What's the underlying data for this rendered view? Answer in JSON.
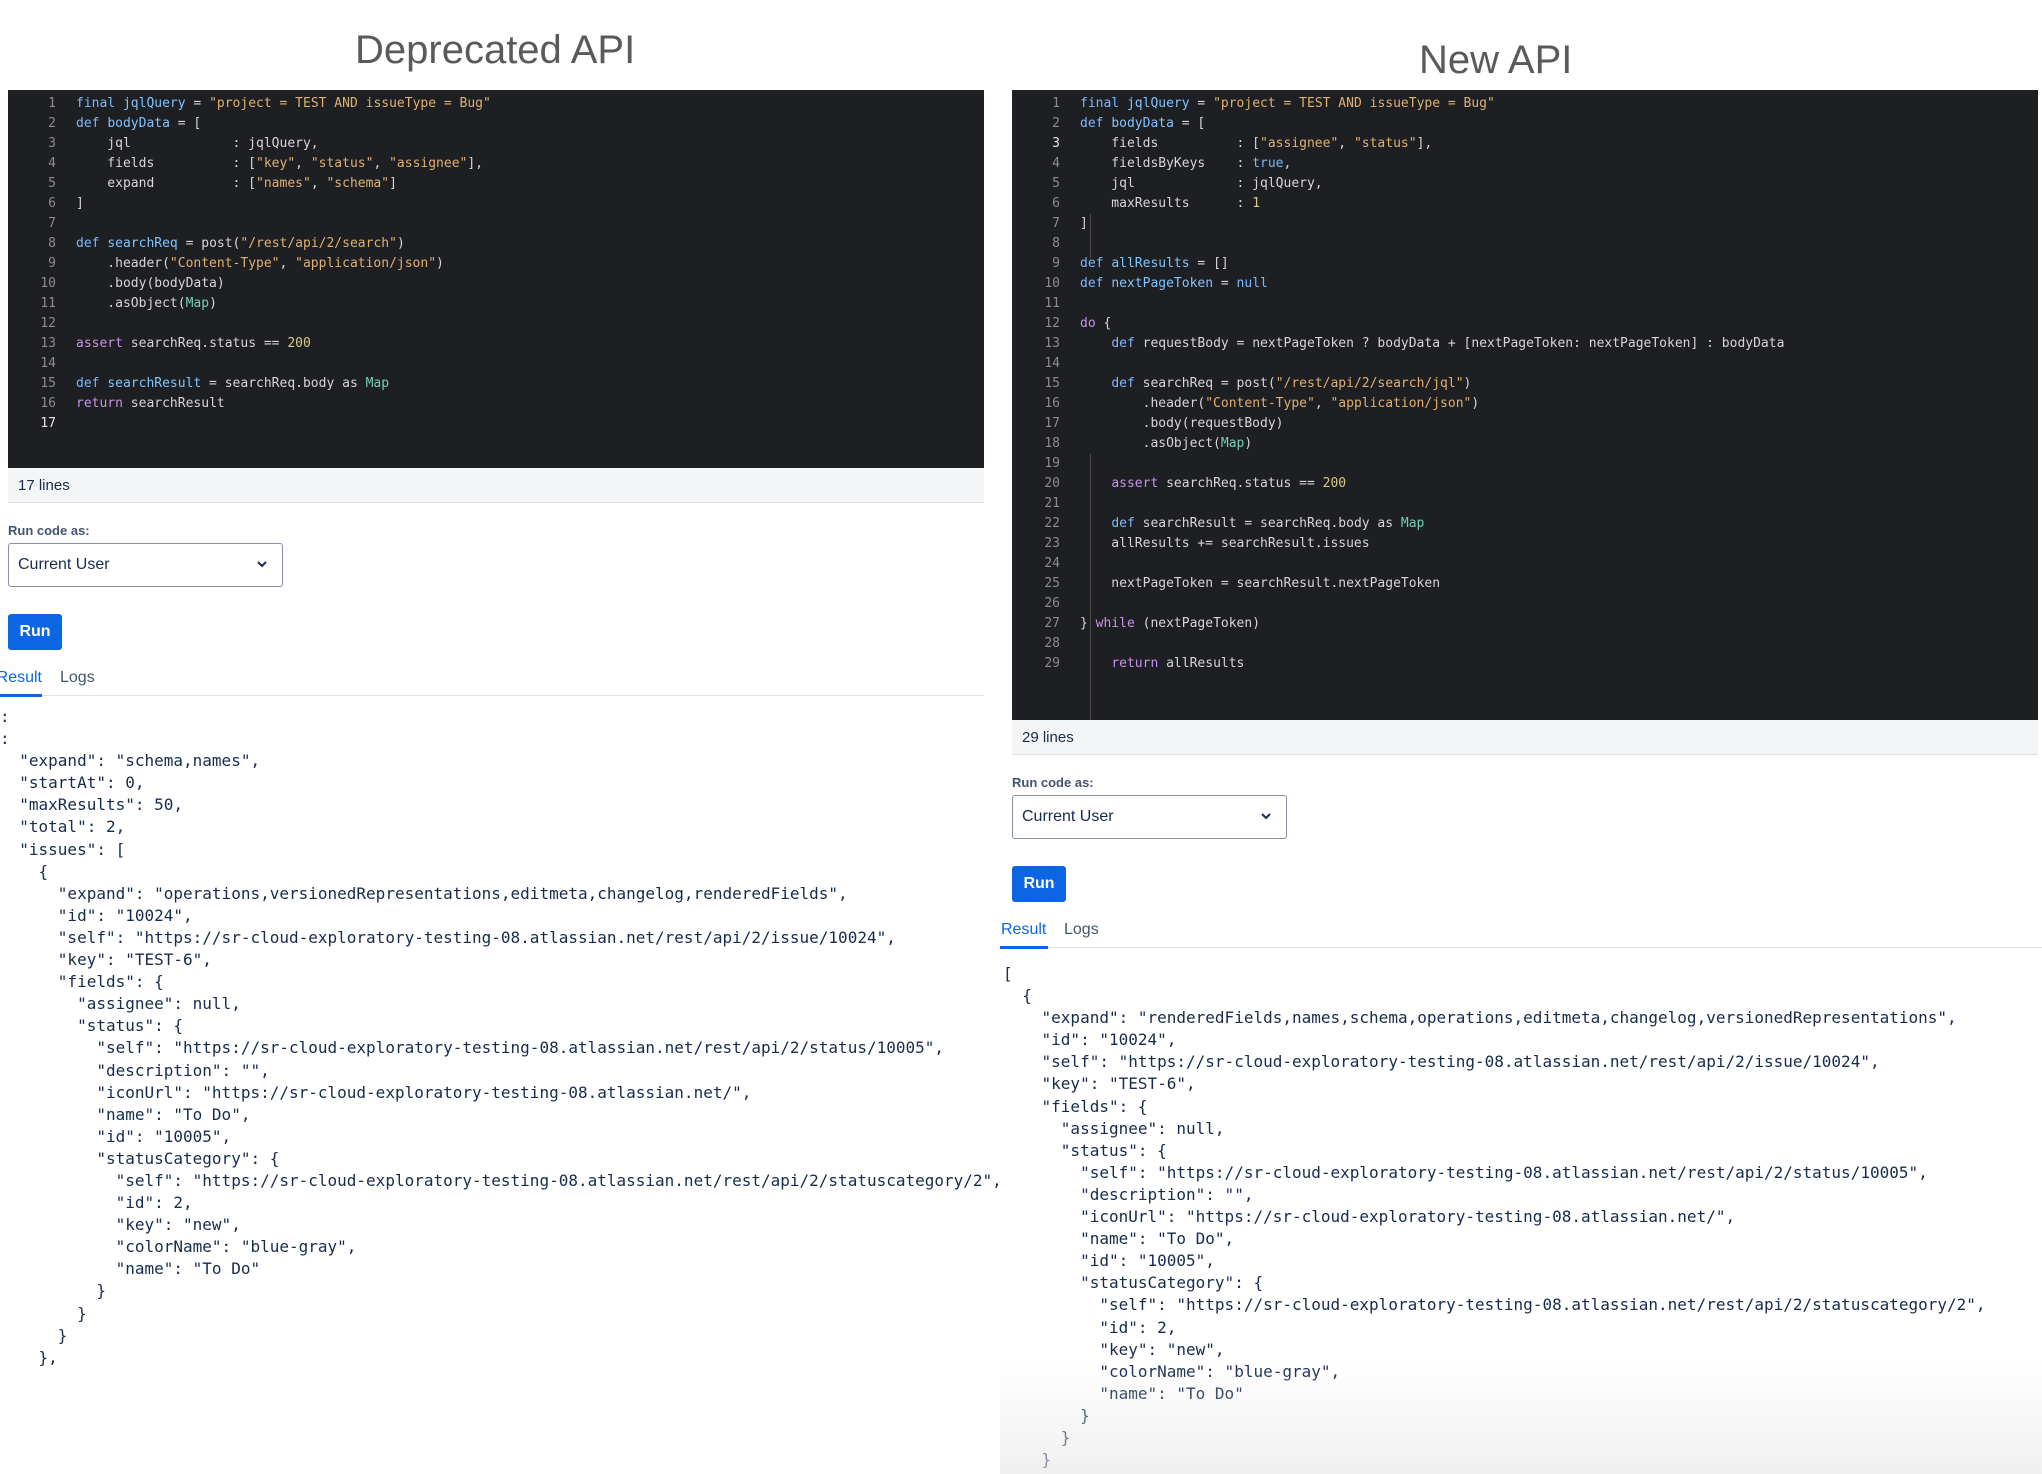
{
  "deprecated": {
    "title": "Deprecated API",
    "code_lines": [
      [
        [
          "kb",
          "final "
        ],
        [
          "fn",
          "jqlQuery"
        ],
        [
          "t",
          " = "
        ],
        [
          "str",
          "\"project = TEST AND issueType = Bug\""
        ]
      ],
      [
        [
          "kb",
          "def "
        ],
        [
          "fn",
          "bodyData"
        ],
        [
          "t",
          " = ["
        ]
      ],
      [
        [
          "t",
          "    jql             : jqlQuery,"
        ]
      ],
      [
        [
          "t",
          "    fields          : ["
        ],
        [
          "str",
          "\"key\""
        ],
        [
          "t",
          ", "
        ],
        [
          "str",
          "\"status\""
        ],
        [
          "t",
          ", "
        ],
        [
          "str",
          "\"assignee\""
        ],
        [
          "t",
          "],"
        ]
      ],
      [
        [
          "t",
          "    expand          : ["
        ],
        [
          "str",
          "\"names\""
        ],
        [
          "t",
          ", "
        ],
        [
          "str",
          "\"schema\""
        ],
        [
          "t",
          "]"
        ]
      ],
      [
        [
          "t",
          "]"
        ]
      ],
      [],
      [
        [
          "kb",
          "def "
        ],
        [
          "fn",
          "searchReq"
        ],
        [
          "t",
          " = post("
        ],
        [
          "str",
          "\"/rest/api/2/search\""
        ],
        [
          "t",
          ")"
        ]
      ],
      [
        [
          "t",
          "    .header("
        ],
        [
          "str",
          "\"Content-Type\""
        ],
        [
          "t",
          ", "
        ],
        [
          "str",
          "\"application/json\""
        ],
        [
          "t",
          ")"
        ]
      ],
      [
        [
          "t",
          "    .body(bodyData)"
        ]
      ],
      [
        [
          "t",
          "    .asObject("
        ],
        [
          "typ",
          "Map"
        ],
        [
          "t",
          ")"
        ]
      ],
      [],
      [
        [
          "kw",
          "assert "
        ],
        [
          "t",
          "searchReq.status == "
        ],
        [
          "num",
          "200"
        ]
      ],
      [],
      [
        [
          "kb",
          "def "
        ],
        [
          "fn",
          "searchResult"
        ],
        [
          "t",
          " = searchReq.body as "
        ],
        [
          "typ",
          "Map"
        ]
      ],
      [
        [
          "kw",
          "return "
        ],
        [
          "t",
          "searchResult"
        ]
      ],
      []
    ],
    "active_line": 17,
    "line_count_label": "17 lines",
    "run_as_label": "Run code as:",
    "run_as_value": "Current User",
    "run_button": "Run",
    "tabs": {
      "result": "Result",
      "logs": "Logs"
    },
    "result_text": ":\n:\n  \"expand\": \"schema,names\",\n  \"startAt\": 0,\n  \"maxResults\": 50,\n  \"total\": 2,\n  \"issues\": [\n    {\n      \"expand\": \"operations,versionedRepresentations,editmeta,changelog,renderedFields\",\n      \"id\": \"10024\",\n      \"self\": \"https://sr-cloud-exploratory-testing-08.atlassian.net/rest/api/2/issue/10024\",\n      \"key\": \"TEST-6\",\n      \"fields\": {\n        \"assignee\": null,\n        \"status\": {\n          \"self\": \"https://sr-cloud-exploratory-testing-08.atlassian.net/rest/api/2/status/10005\",\n          \"description\": \"\",\n          \"iconUrl\": \"https://sr-cloud-exploratory-testing-08.atlassian.net/\",\n          \"name\": \"To Do\",\n          \"id\": \"10005\",\n          \"statusCategory\": {\n            \"self\": \"https://sr-cloud-exploratory-testing-08.atlassian.net/rest/api/2/statuscategory/2\",\n            \"id\": 2,\n            \"key\": \"new\",\n            \"colorName\": \"blue-gray\",\n            \"name\": \"To Do\"\n          }\n        }\n      }\n    },"
  },
  "new_api": {
    "title": "New API",
    "code_lines": [
      [
        [
          "kb",
          "final "
        ],
        [
          "fn",
          "jqlQuery"
        ],
        [
          "t",
          " = "
        ],
        [
          "str",
          "\"project = TEST AND issueType = Bug\""
        ]
      ],
      [
        [
          "kb",
          "def "
        ],
        [
          "fn",
          "bodyData"
        ],
        [
          "t",
          " = ["
        ]
      ],
      [
        [
          "t",
          "    fields          : ["
        ],
        [
          "str",
          "\"assignee\""
        ],
        [
          "t",
          ", "
        ],
        [
          "str",
          "\"status\""
        ],
        [
          "t",
          "],"
        ]
      ],
      [
        [
          "t",
          "    fieldsByKeys    : "
        ],
        [
          "kb",
          "true"
        ],
        [
          "t",
          ","
        ]
      ],
      [
        [
          "t",
          "    jql             : jqlQuery,"
        ]
      ],
      [
        [
          "t",
          "    maxResults      : "
        ],
        [
          "num",
          "1"
        ]
      ],
      [
        [
          "t",
          "]"
        ]
      ],
      [],
      [
        [
          "kb",
          "def "
        ],
        [
          "fn",
          "allResults"
        ],
        [
          "t",
          " = []"
        ]
      ],
      [
        [
          "kb",
          "def "
        ],
        [
          "fn",
          "nextPageToken"
        ],
        [
          "t",
          " = "
        ],
        [
          "kb",
          "null"
        ]
      ],
      [],
      [
        [
          "kw",
          "do"
        ],
        [
          "t",
          " {"
        ]
      ],
      [
        [
          "t",
          "    "
        ],
        [
          "kb",
          "def "
        ],
        [
          "t",
          "requestBody = nextPageToken ? bodyData + [nextPageToken: nextPageToken] : bodyData"
        ]
      ],
      [],
      [
        [
          "t",
          "    "
        ],
        [
          "kb",
          "def "
        ],
        [
          "t",
          "searchReq = post("
        ],
        [
          "str",
          "\"/rest/api/2/search/jql\""
        ],
        [
          "t",
          ")"
        ]
      ],
      [
        [
          "t",
          "        .header("
        ],
        [
          "str",
          "\"Content-Type\""
        ],
        [
          "t",
          ", "
        ],
        [
          "str",
          "\"application/json\""
        ],
        [
          "t",
          ")"
        ]
      ],
      [
        [
          "t",
          "        .body(requestBody)"
        ]
      ],
      [
        [
          "t",
          "        .asObject("
        ],
        [
          "typ",
          "Map"
        ],
        [
          "t",
          ")"
        ]
      ],
      [],
      [
        [
          "t",
          "    "
        ],
        [
          "kw",
          "assert "
        ],
        [
          "t",
          "searchReq.status == "
        ],
        [
          "num",
          "200"
        ]
      ],
      [],
      [
        [
          "t",
          "    "
        ],
        [
          "kb",
          "def "
        ],
        [
          "t",
          "searchResult = searchReq.body as "
        ],
        [
          "typ",
          "Map"
        ]
      ],
      [
        [
          "t",
          "    allResults += searchResult.issues"
        ]
      ],
      [],
      [
        [
          "t",
          "    nextPageToken = searchResult.nextPageToken"
        ]
      ],
      [],
      [
        [
          "t",
          "} "
        ],
        [
          "kw",
          "while"
        ],
        [
          "t",
          " (nextPageToken)"
        ]
      ],
      [],
      [
        [
          "t",
          "    "
        ],
        [
          "kw",
          "return "
        ],
        [
          "t",
          "allResults"
        ]
      ]
    ],
    "active_line": 3,
    "line_count_label": "29 lines",
    "run_as_label": "Run code as:",
    "run_as_value": "Current User",
    "run_button": "Run",
    "tabs": {
      "result": "Result",
      "logs": "Logs"
    },
    "result_text": "[\n  {\n    \"expand\": \"renderedFields,names,schema,operations,editmeta,changelog,versionedRepresentations\",\n    \"id\": \"10024\",\n    \"self\": \"https://sr-cloud-exploratory-testing-08.atlassian.net/rest/api/2/issue/10024\",\n    \"key\": \"TEST-6\",\n    \"fields\": {\n      \"assignee\": null,\n      \"status\": {\n        \"self\": \"https://sr-cloud-exploratory-testing-08.atlassian.net/rest/api/2/status/10005\",\n        \"description\": \"\",\n        \"iconUrl\": \"https://sr-cloud-exploratory-testing-08.atlassian.net/\",\n        \"name\": \"To Do\",\n        \"id\": \"10005\",\n        \"statusCategory\": {\n          \"self\": \"https://sr-cloud-exploratory-testing-08.atlassian.net/rest/api/2/statuscategory/2\",\n          \"id\": 2,\n          \"key\": \"new\",\n          \"colorName\": \"blue-gray\",\n          \"name\": \"To Do\"\n        }\n      }\n    }"
  }
}
